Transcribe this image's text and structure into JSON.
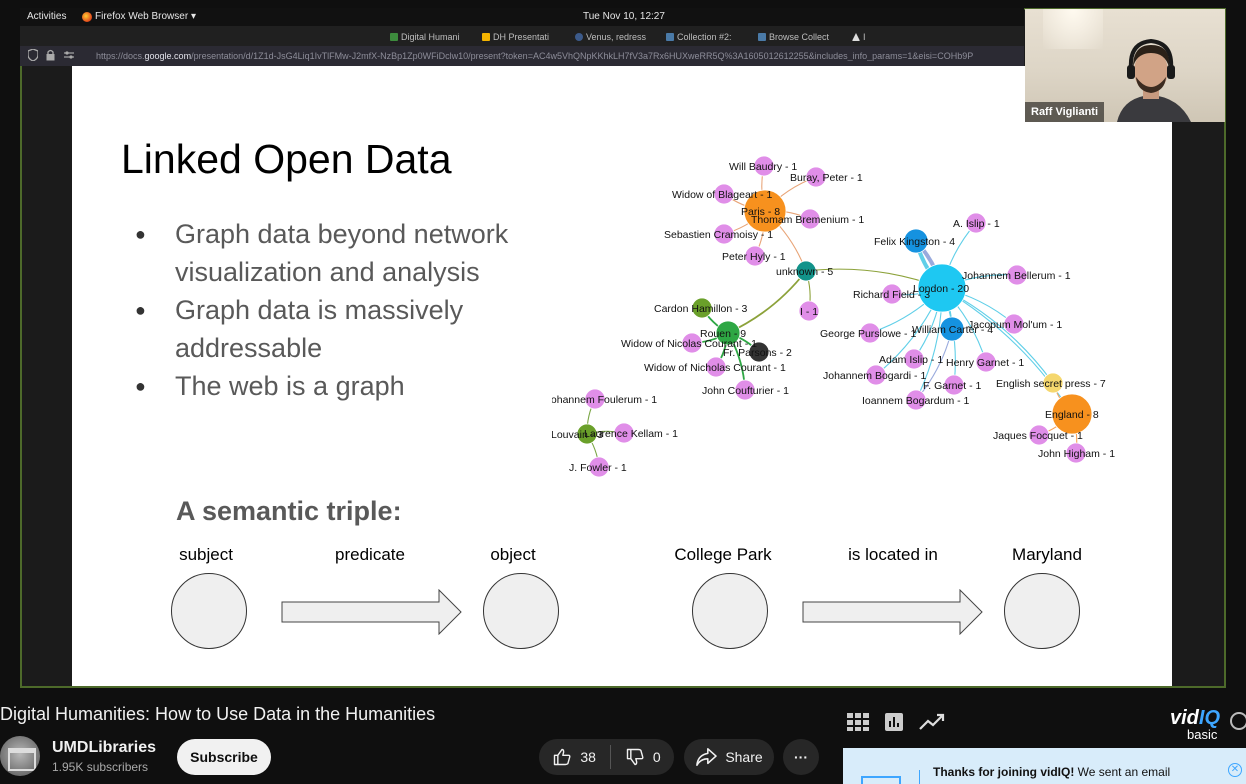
{
  "desktop": {
    "activities_label": "Activities",
    "app_name": "Firefox Web Browser ▾",
    "clock": "Tue Nov 10, 12:27"
  },
  "browser": {
    "tabs": [
      "Digital Humani",
      "DH Presentati",
      "Collection #2:",
      "Venus, redress",
      "Browse Collect",
      "I"
    ],
    "url_prefix": "https://docs.",
    "url_domain": "google.com",
    "url_rest": "/presentation/d/1Z1d-JsG4Liq1IvTlFMw-J2mfX-NzBp1Zp0WFiDclw10/present?token=AC4w5VhQNpKKhkLH7fV3a7Rx6HUXweRR5Q%3A1605012612255&includes_info_params=1&eisi=COHb9P"
  },
  "slide": {
    "title": "Linked Open Data",
    "bullets": [
      "Graph data beyond network visualization and analysis",
      "Graph data is massively addressable",
      "The web is a graph"
    ],
    "triple_heading": "A semantic triple:",
    "triple_labels": [
      "subject",
      "predicate",
      "object"
    ],
    "example_labels": [
      "College Park",
      "is located in",
      "Maryland"
    ]
  },
  "graph": {
    "colors": {
      "pink": "#e08ee8",
      "cyan": "#1ec8f2",
      "blue": "#1592e0",
      "orange": "#f7911e",
      "teal": "#12938a",
      "green": "#2ea744",
      "olive": "#6aa02a",
      "dark": "#333333",
      "yellow": "#f5d76e"
    },
    "nodes": [
      {
        "label": "Will Baudry - 1",
        "color": "pink"
      },
      {
        "label": "Buray, Peter - 1",
        "color": "pink"
      },
      {
        "label": "Widow of Blageart - 1",
        "color": "pink"
      },
      {
        "label": "Paris - 8",
        "color": "orange"
      },
      {
        "label": "Thomam Bremenium - 1",
        "color": "pink"
      },
      {
        "label": "Sebastien Cramoisy - 1",
        "color": "pink"
      },
      {
        "label": "Peter Hyly - 1",
        "color": "pink"
      },
      {
        "label": "unknown - 5",
        "color": "teal"
      },
      {
        "label": "A. Islip - 1",
        "color": "pink"
      },
      {
        "label": "Felix Kingston - 4",
        "color": "blue"
      },
      {
        "label": "Johannem Bellerum - 1",
        "color": "pink"
      },
      {
        "label": "London - 20",
        "color": "cyan"
      },
      {
        "label": "Richard Field - 3",
        "color": "pink"
      },
      {
        "label": "Cardon Hamillon - 3",
        "color": "olive"
      },
      {
        "label": "I - 1",
        "color": "pink"
      },
      {
        "label": "Rouen - 9",
        "color": "green"
      },
      {
        "label": "Widow of Nicolas Courant - 1",
        "color": "pink"
      },
      {
        "label": "Fr. Parsons - 2",
        "color": "dark"
      },
      {
        "label": "Widow of Nicholas Courant - 1",
        "color": "pink"
      },
      {
        "label": "John Coufturier - 1",
        "color": "pink"
      },
      {
        "label": "George Purslowe - 1",
        "color": "pink"
      },
      {
        "label": "William Carter - 4",
        "color": "blue"
      },
      {
        "label": "Jacopum Mol'um - 1",
        "color": "pink"
      },
      {
        "label": "Adam Islip - 1",
        "color": "pink"
      },
      {
        "label": "Henry Garnet - 1",
        "color": "pink"
      },
      {
        "label": "Johannem Bogardi - 1",
        "color": "pink"
      },
      {
        "label": "F. Garnet - 1",
        "color": "pink"
      },
      {
        "label": "English secret press - 7",
        "color": "yellow"
      },
      {
        "label": "Ioannem Bogardum - 1",
        "color": "pink"
      },
      {
        "label": "England - 8",
        "color": "orange"
      },
      {
        "label": "Jaques Focquet - 1",
        "color": "pink"
      },
      {
        "label": "John Higham - 1",
        "color": "pink"
      },
      {
        "label": "Iohannem Foulerum - 1",
        "color": "pink"
      },
      {
        "label": "Louvain - 3",
        "color": "olive"
      },
      {
        "label": "Laurence Kellam - 1",
        "color": "pink"
      },
      {
        "label": "J. Fowler - 1",
        "color": "pink"
      }
    ]
  },
  "webcam": {
    "name": "Raff Viglianti"
  },
  "video": {
    "title": "Digital Humanities: How to Use Data in the Humanities",
    "channel": "UMDLibraries",
    "subscribers": "1.95K subscribers",
    "subscribe_label": "Subscribe",
    "likes": "38",
    "dislikes": "0",
    "share_label": "Share",
    "more_label": "···"
  },
  "vidiq": {
    "brand_prefix": "vid",
    "brand_suffix": "IQ",
    "plan": "basic",
    "toast_bold": "Thanks for joining vidIQ!",
    "toast_rest": " We sent an email",
    "close_label": "✕"
  }
}
